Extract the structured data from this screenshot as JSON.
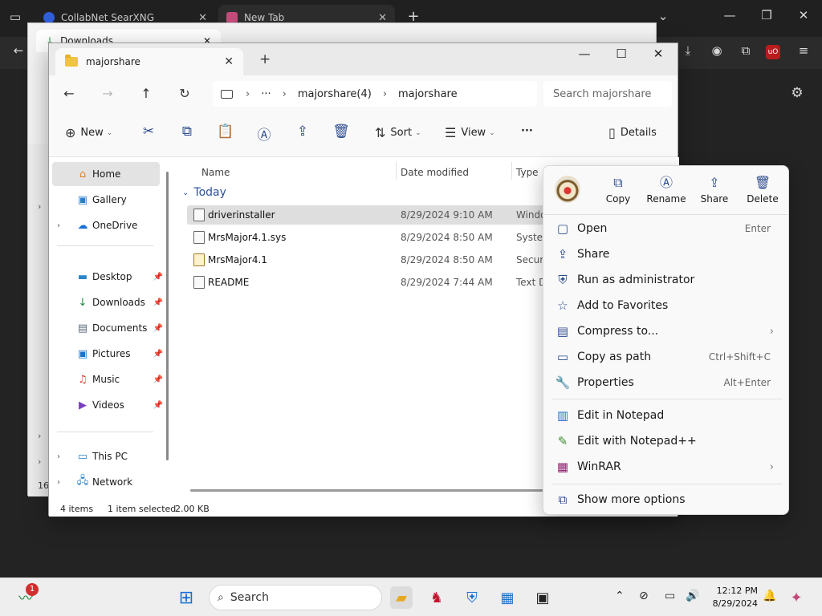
{
  "browser": {
    "tabs": [
      {
        "label": "CollabNet SearXNG"
      },
      {
        "label": "New Tab"
      }
    ]
  },
  "downloads_window": {
    "tab_label": "Downloads",
    "side_number": "16"
  },
  "explorer": {
    "tab_label": "majorshare",
    "address": {
      "ellipsis": "···",
      "parent": "majorshare(4)",
      "current": "majorshare"
    },
    "search_placeholder": "Search majorshare",
    "commands": {
      "new": "New",
      "sort": "Sort",
      "view": "View",
      "more": "···",
      "details": "Details"
    },
    "nav": {
      "home": "Home",
      "gallery": "Gallery",
      "onedrive": "OneDrive",
      "desktop": "Desktop",
      "downloads": "Downloads",
      "documents": "Documents",
      "pictures": "Pictures",
      "music": "Music",
      "videos": "Videos",
      "thispc": "This PC",
      "network": "Network"
    },
    "columns": {
      "name": "Name",
      "date": "Date modified",
      "type": "Type"
    },
    "group": "Today",
    "files": [
      {
        "name": "driverinstaller",
        "date": "8/29/2024 9:10 AM",
        "type": "Windo"
      },
      {
        "name": "MrsMajor4.1.sys",
        "date": "8/29/2024 8:50 AM",
        "type": "System"
      },
      {
        "name": "MrsMajor4.1",
        "date": "8/29/2024 8:50 AM",
        "type": "Securi"
      },
      {
        "name": "README",
        "date": "8/29/2024 7:44 AM",
        "type": "Text D"
      }
    ],
    "status": {
      "items": "4 items",
      "selected": "1 item selected",
      "size": "2.00 KB"
    }
  },
  "context_menu": {
    "quick": {
      "copy": "Copy",
      "rename": "Rename",
      "share": "Share",
      "delete": "Delete"
    },
    "items": {
      "open": {
        "label": "Open",
        "shortcut": "Enter"
      },
      "share": {
        "label": "Share"
      },
      "runadmin": {
        "label": "Run as administrator"
      },
      "favorites": {
        "label": "Add to Favorites"
      },
      "compress": {
        "label": "Compress to..."
      },
      "copypath": {
        "label": "Copy as path",
        "shortcut": "Ctrl+Shift+C"
      },
      "properties": {
        "label": "Properties",
        "shortcut": "Alt+Enter"
      },
      "notepad": {
        "label": "Edit in Notepad"
      },
      "notepadpp": {
        "label": "Edit with Notepad++"
      },
      "winrar": {
        "label": "WinRAR"
      },
      "more": {
        "label": "Show more options"
      }
    }
  },
  "taskbar": {
    "search": "Search",
    "widget_badge": "1",
    "time": "12:12 PM",
    "date": "8/29/2024"
  },
  "colors": {
    "accent": "#2d4c8e",
    "folder": "#f0c342",
    "selection": "#dedede"
  }
}
